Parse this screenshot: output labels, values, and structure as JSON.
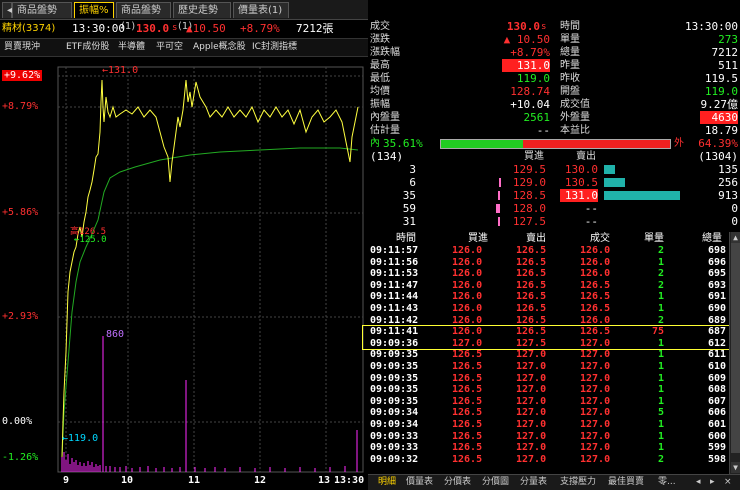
{
  "tabs": [
    {
      "label": "商品盤勢",
      "active": false
    },
    {
      "label": "振幅%",
      "active": true
    },
    {
      "label": "商品盤勢(1)",
      "active": false
    },
    {
      "label": "歷史走勢(1)",
      "active": false
    },
    {
      "label": "價量表(1)",
      "active": false
    }
  ],
  "stock": {
    "name": "精材(3374)",
    "time": "13:30:00",
    "price": "130.0",
    "price_suffix": "s",
    "change": "▲10.50",
    "pct": "+8.79%",
    "volume": "7212張"
  },
  "toolbar": [
    "買賣現沖",
    "ETF成份股",
    "半導體",
    "平可空",
    "Apple概念股",
    "IC封測指標"
  ],
  "chart": {
    "y_labels": [
      "+9.62%",
      "+8.79%",
      "+5.86%",
      "+2.93%",
      "0.00%",
      "-1.26%"
    ],
    "x_labels": [
      "9",
      "10",
      "11",
      "12",
      "13",
      "13:30"
    ],
    "annotations": {
      "high": "←131.0",
      "low": "←119.0",
      "vol_peak": "860",
      "price_mark": "高126.5",
      "avg_mark": "←125.0"
    }
  },
  "quote": {
    "left": [
      {
        "label": "成交",
        "value": "130.0",
        "suffix": "s",
        "color": "red"
      },
      {
        "label": "漲跌",
        "value": "▲ 10.50",
        "color": "red"
      },
      {
        "label": "漲跌幅",
        "value": "+8.79%",
        "color": "red"
      },
      {
        "label": "最高",
        "value": "131.0",
        "color": "hl"
      },
      {
        "label": "最低",
        "value": "119.0",
        "color": "green"
      },
      {
        "label": "均價",
        "value": "128.74",
        "color": "red"
      },
      {
        "label": "振幅",
        "value": "+10.04",
        "color": "white"
      },
      {
        "label": "內盤量",
        "value": "2561",
        "color": "green"
      },
      {
        "label": "估計量",
        "value": "--",
        "color": "white"
      }
    ],
    "right": [
      {
        "label": "時間",
        "value": "13:30:00",
        "color": "white"
      },
      {
        "label": "單量",
        "value": "273",
        "color": "green"
      },
      {
        "label": "總量",
        "value": "7212",
        "color": "white"
      },
      {
        "label": "昨量",
        "value": "511",
        "color": "white"
      },
      {
        "label": "昨收",
        "value": "119.5",
        "color": "white"
      },
      {
        "label": "開盤",
        "value": "119.0",
        "color": "green"
      },
      {
        "label": "成交值",
        "value": "9.27億",
        "color": "white"
      },
      {
        "label": "外盤量",
        "value": "4630",
        "color": "hl"
      },
      {
        "label": "本益比",
        "value": "18.79",
        "color": "white"
      }
    ],
    "inner_label": "內",
    "inner_pct": "35.61%",
    "outer_label": "外",
    "outer_pct": "64.39%",
    "bid_total": "(134)",
    "ask_total": "(1304)",
    "book_head": {
      "bid": "買進",
      "ask": "賣出"
    },
    "book": [
      {
        "bq": "3",
        "bp": "129.5",
        "ap": "130.0",
        "aq": "135",
        "bbar": 0,
        "abar": 0.15
      },
      {
        "bq": "6",
        "bp": "129.0",
        "ap": "130.5",
        "aq": "256",
        "bbar": 0.01,
        "abar": 0.28
      },
      {
        "bq": "35",
        "bp": "128.5",
        "ap": "131.0",
        "aq": "913",
        "bbar": 0.04,
        "abar": 1.0
      },
      {
        "bq": "59",
        "bp": "128.0",
        "ap": "--",
        "aq": "0",
        "bbar": 0.06,
        "abar": 0
      },
      {
        "bq": "31",
        "bp": "127.5",
        "ap": "--",
        "aq": "0",
        "bbar": 0.03,
        "abar": 0
      }
    ]
  },
  "ticks": {
    "headers": [
      "時間",
      "買進",
      "賣出",
      "成交",
      "單量",
      "總量"
    ],
    "rows": [
      [
        "09:11:57",
        "126.0",
        "126.5",
        "126.0",
        "2",
        "698"
      ],
      [
        "09:11:56",
        "126.0",
        "126.5",
        "126.0",
        "1",
        "696"
      ],
      [
        "09:11:53",
        "126.0",
        "126.5",
        "126.0",
        "2",
        "695"
      ],
      [
        "09:11:47",
        "126.0",
        "126.5",
        "126.5",
        "2",
        "693"
      ],
      [
        "09:11:44",
        "126.0",
        "126.5",
        "126.5",
        "1",
        "691"
      ],
      [
        "09:11:43",
        "126.0",
        "126.5",
        "126.5",
        "1",
        "690"
      ],
      [
        "09:11:42",
        "126.0",
        "126.5",
        "126.0",
        "2",
        "689"
      ],
      [
        "09:11:41",
        "126.0",
        "126.5",
        "126.5",
        "75",
        "687"
      ],
      [
        "09:09:36",
        "127.0",
        "127.5",
        "127.0",
        "1",
        "612"
      ],
      [
        "09:09:35",
        "126.5",
        "127.0",
        "127.0",
        "1",
        "611"
      ],
      [
        "09:09:35",
        "126.5",
        "127.0",
        "127.0",
        "1",
        "610"
      ],
      [
        "09:09:35",
        "126.5",
        "127.0",
        "127.0",
        "1",
        "609"
      ],
      [
        "09:09:35",
        "126.5",
        "127.0",
        "127.0",
        "1",
        "608"
      ],
      [
        "09:09:35",
        "126.5",
        "127.0",
        "127.0",
        "1",
        "607"
      ],
      [
        "09:09:34",
        "126.5",
        "127.0",
        "127.0",
        "5",
        "606"
      ],
      [
        "09:09:34",
        "126.5",
        "127.0",
        "127.0",
        "1",
        "601"
      ],
      [
        "09:09:33",
        "126.5",
        "127.0",
        "127.0",
        "1",
        "600"
      ],
      [
        "09:09:33",
        "126.5",
        "127.0",
        "127.0",
        "1",
        "599"
      ],
      [
        "09:09:32",
        "126.5",
        "127.0",
        "127.0",
        "2",
        "598"
      ]
    ]
  },
  "bottom_tabs": [
    "明細",
    "價量表",
    "分價表",
    "分價圖",
    "分量表",
    "支撐壓力",
    "最佳買賣",
    "零..."
  ]
}
